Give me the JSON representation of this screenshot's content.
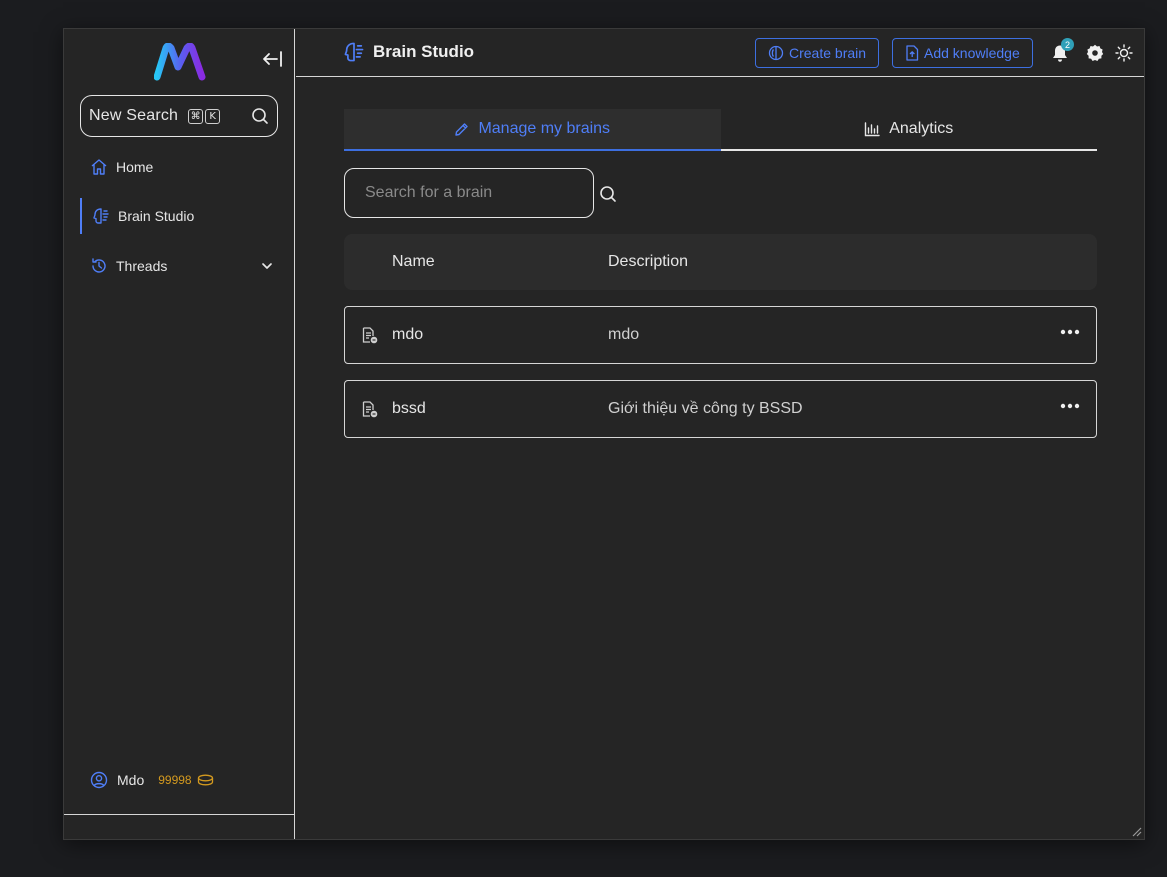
{
  "sidebar": {
    "search_label": "New Search",
    "shortcut_keys": [
      "⌘",
      "K"
    ],
    "nav": [
      {
        "label": "Home",
        "icon": "home-icon"
      },
      {
        "label": "Brain Studio",
        "icon": "brain-icon"
      },
      {
        "label": "Threads",
        "icon": "history-icon"
      }
    ],
    "user": {
      "name": "Mdo",
      "credits": "99998"
    }
  },
  "header": {
    "title": "Brain Studio",
    "create_brain_label": "Create brain",
    "add_knowledge_label": "Add knowledge",
    "notification_count": "2"
  },
  "main": {
    "tabs": [
      {
        "label": "Manage my brains",
        "active": true
      },
      {
        "label": "Analytics",
        "active": false
      }
    ],
    "search_placeholder": "Search for a brain",
    "table_headers": {
      "name": "Name",
      "description": "Description"
    },
    "brains": [
      {
        "name": "mdo",
        "description": "mdo"
      },
      {
        "name": "bssd",
        "description": "Giới thiệu về công ty BSSD"
      }
    ]
  },
  "colors": {
    "accent": "#4f7ef7",
    "background": "#252525",
    "credits": "#d49a1f",
    "badge": "#2fa0b8"
  }
}
